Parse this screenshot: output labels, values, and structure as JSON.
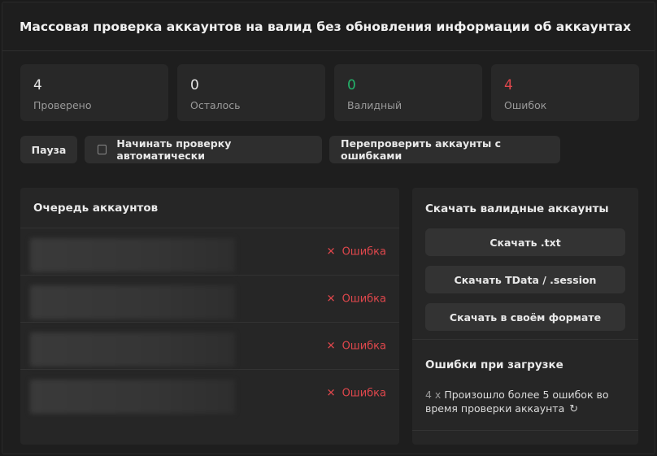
{
  "header": {
    "title": "Массовая проверка аккаунтов на валид без обновления информации об аккаунтах"
  },
  "stats": [
    {
      "value": "4",
      "label": "Проверено",
      "color": "#e6e6e6"
    },
    {
      "value": "0",
      "label": "Осталось",
      "color": "#e6e6e6"
    },
    {
      "value": "0",
      "label": "Валидный",
      "color": "#23b36a"
    },
    {
      "value": "4",
      "label": "Ошибок",
      "color": "#e0474c"
    }
  ],
  "controls": {
    "pause_label": "Пауза",
    "auto_start_label": "Начинать проверку автоматически",
    "auto_start_checked": false,
    "recheck_label": "Перепроверить аккаунты с ошибками"
  },
  "queue": {
    "title": "Очередь аккаунтов",
    "rows": [
      {
        "status": "Ошибка",
        "icon": "x-icon"
      },
      {
        "status": "Ошибка",
        "icon": "x-icon"
      },
      {
        "status": "Ошибка",
        "icon": "x-icon"
      },
      {
        "status": "Ошибка",
        "icon": "x-icon"
      }
    ]
  },
  "downloads": {
    "title": "Скачать валидные аккаунты",
    "txt_label": "Скачать .txt",
    "tdata_label": "Скачать TData / .session",
    "custom_label": "Скачать в своём формате"
  },
  "errors": {
    "title": "Ошибки при загрузке",
    "count": "4 x",
    "message": "Произошло более 5 ошибок во время проверки аккаунта",
    "icon": "reload-icon"
  }
}
